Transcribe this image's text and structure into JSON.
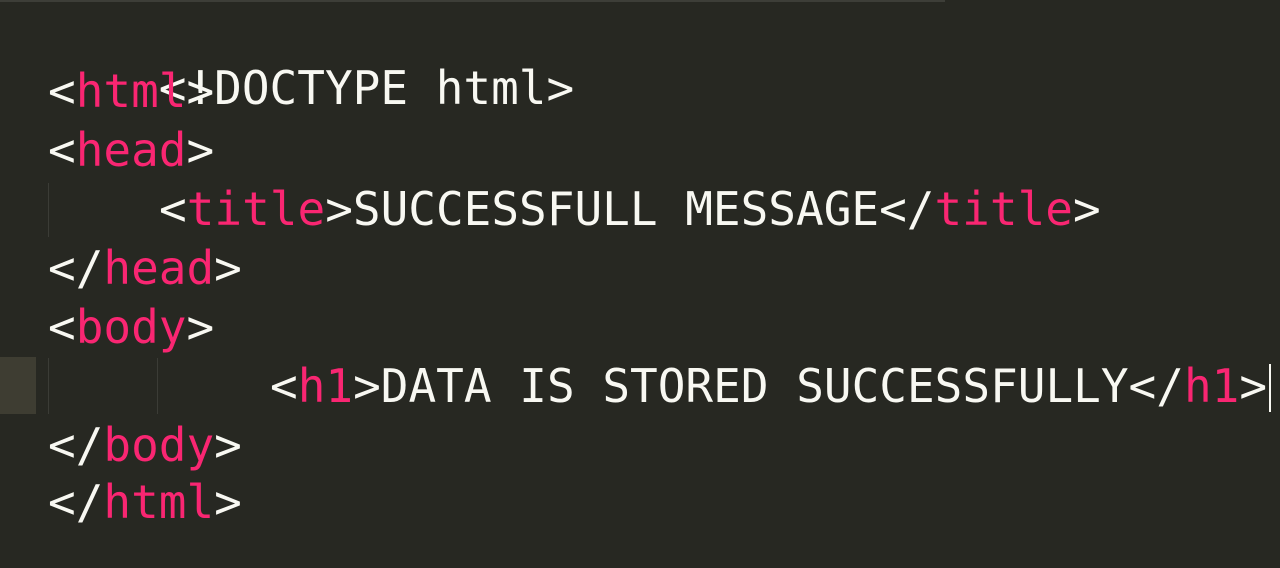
{
  "editor": {
    "colors": {
      "background": "#272822",
      "text": "#F8F8F2",
      "tag_name": "#F92672",
      "active_line_gutter": "#3e3d32"
    },
    "lines": [
      {
        "doctype": "<!DOCTYPE html>"
      },
      {
        "open": "<",
        "tag": "html",
        "close": ">"
      },
      {
        "open": "<",
        "tag": "head",
        "close": ">"
      },
      {
        "open": "<",
        "tag": "title",
        "close": ">",
        "text": "SUCCESSFULL MESSAGE",
        "end_open": "</",
        "end_tag": "title",
        "end_close": ">"
      },
      {
        "open": "</",
        "tag": "head",
        "close": ">"
      },
      {
        "open": "<",
        "tag": "body",
        "close": ">"
      },
      {
        "open": "<",
        "tag": "h1",
        "close": ">",
        "text": "DATA IS STORED SUCCESSFULLY",
        "end_open": "</",
        "end_tag": "h1",
        "end_close": ">"
      },
      {
        "open": "</",
        "tag": "body",
        "close": ">"
      },
      {
        "open": "</",
        "tag": "html",
        "close": ">"
      }
    ]
  }
}
